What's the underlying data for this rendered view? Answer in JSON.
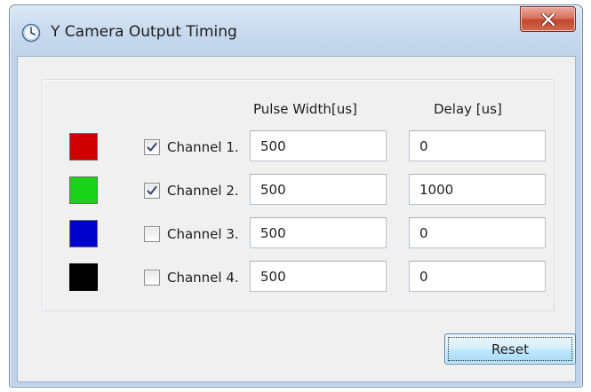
{
  "window": {
    "title": "Y Camera Output Timing",
    "icon": "clock-icon"
  },
  "close_button": {
    "icon": "close-x-icon",
    "color": "#c84630"
  },
  "headers": {
    "pulse_width": "Pulse Width[us]",
    "delay": "Delay [us]"
  },
  "channels": [
    {
      "label": "Channel 1.",
      "color": "#d10000",
      "checked": true,
      "pulse_width": "500",
      "delay": "0"
    },
    {
      "label": "Channel 2.",
      "color": "#1bd21b",
      "checked": true,
      "pulse_width": "500",
      "delay": "1000"
    },
    {
      "label": "Channel 3.",
      "color": "#0000cc",
      "checked": false,
      "pulse_width": "500",
      "delay": "0"
    },
    {
      "label": "Channel 4.",
      "color": "#000000",
      "checked": false,
      "pulse_width": "500",
      "delay": "0"
    }
  ],
  "reset_button": {
    "label": "Reset"
  }
}
